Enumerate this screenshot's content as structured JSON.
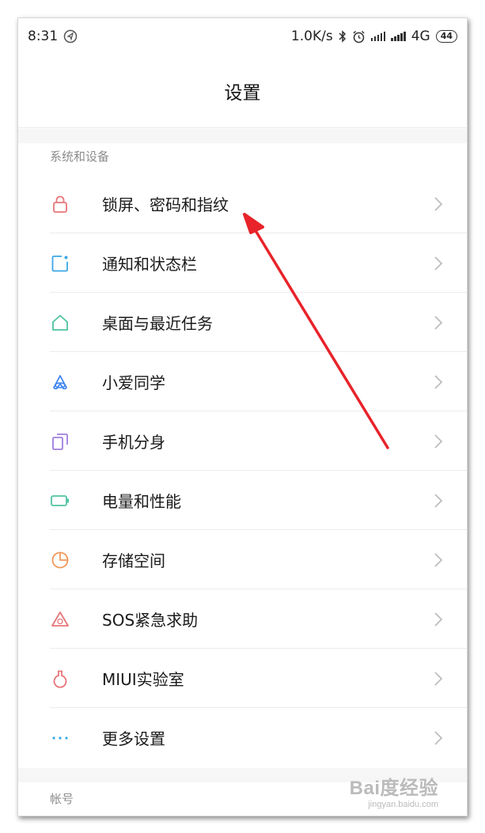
{
  "status_bar": {
    "time": "8:31",
    "net_speed": "1.0K/s",
    "network": "4G",
    "battery": "44"
  },
  "header": {
    "title": "设置"
  },
  "section_system": {
    "label": "系统和设备",
    "items": [
      {
        "label": "锁屏、密码和指纹",
        "icon": "lock-icon",
        "color": "#e8757a"
      },
      {
        "label": "通知和状态栏",
        "icon": "notification-icon",
        "color": "#3aa7e6"
      },
      {
        "label": "桌面与最近任务",
        "icon": "home-icon",
        "color": "#4ec3a0"
      },
      {
        "label": "小爱同学",
        "icon": "xiaoai-icon",
        "color": "#3d86f0"
      },
      {
        "label": "手机分身",
        "icon": "dual-phone-icon",
        "color": "#a17ee0"
      },
      {
        "label": "电量和性能",
        "icon": "battery-icon",
        "color": "#4ec3a0"
      },
      {
        "label": "存储空间",
        "icon": "storage-pie-icon",
        "color": "#f0985a"
      },
      {
        "label": "SOS紧急求助",
        "icon": "sos-icon",
        "color": "#e8757a"
      },
      {
        "label": "MIUI实验室",
        "icon": "lab-flask-icon",
        "color": "#e8757a"
      },
      {
        "label": "更多设置",
        "icon": "more-dots-icon",
        "color": "#3aa7e6"
      }
    ]
  },
  "section_account": {
    "label": "帐号"
  },
  "watermark": {
    "brand": "Bai度经验",
    "url": "jingyan.baidu.com"
  },
  "annotation_color": "#e8232a"
}
